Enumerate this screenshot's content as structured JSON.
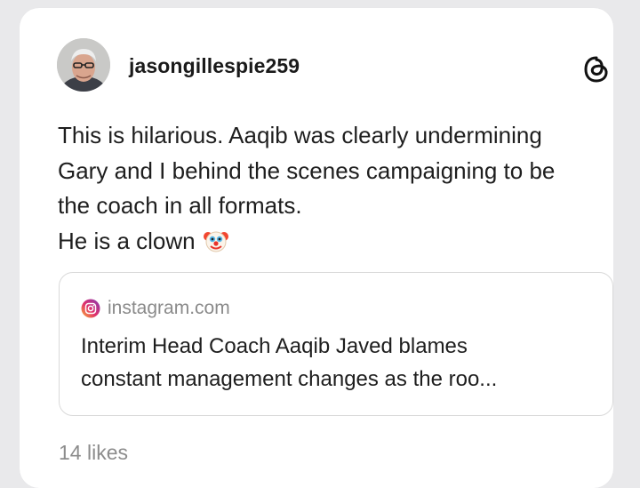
{
  "post": {
    "username": "jasongillespie259",
    "text_lines": [
      "This is hilarious. Aaqib was clearly undermining",
      "Gary and I behind the scenes campaigning to be",
      "the coach in all formats.",
      "He is a clown"
    ],
    "emoji": "clown-face",
    "likes": "14 likes"
  },
  "link_preview": {
    "domain": "instagram.com",
    "title_lines": [
      "Interim Head Coach Aaqib Javed blames",
      "constant management changes as the roo..."
    ]
  },
  "icons": {
    "app": "threads-icon",
    "source": "instagram-icon",
    "avatar": "avatar"
  }
}
